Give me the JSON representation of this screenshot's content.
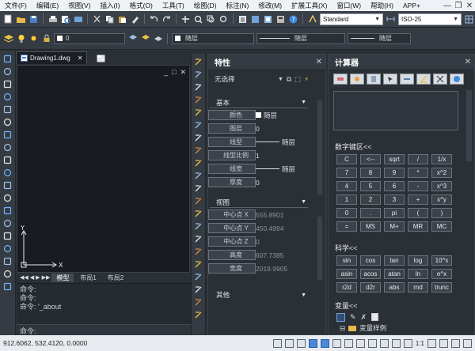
{
  "menu": {
    "items": [
      "文件(F)",
      "编辑(E)",
      "视图(V)",
      "插入(I)",
      "格式(O)",
      "工具(T)",
      "绘图(D)",
      "标注(N)",
      "修改(M)",
      "扩展工具(X)",
      "窗口(W)",
      "帮助(H)",
      "APP+"
    ]
  },
  "toolbar": {
    "text_style": "Standard",
    "dim_style": "ISO-25",
    "table_style": "Standard",
    "layer": "0",
    "color": "随层",
    "linetype": "随层",
    "lineweight": "随层"
  },
  "drawing": {
    "doc_tab": "Drawing1.dwg",
    "view_controls": [
      "_",
      "□",
      "✕"
    ],
    "axis_y": "Y",
    "axis_x": "X",
    "layout_tabs": [
      "模型",
      "布局1",
      "布局2"
    ]
  },
  "command": {
    "lines": [
      "命令:",
      "命令:",
      "命令: '_about",
      "命令:"
    ],
    "prompt": "命令:"
  },
  "properties": {
    "title": "特性",
    "selection": "无选择",
    "sections": {
      "basic": {
        "title": "基本",
        "rows": [
          {
            "k": "颜色",
            "v": "随层"
          },
          {
            "k": "图层",
            "v": "0"
          },
          {
            "k": "线型",
            "v": "随层"
          },
          {
            "k": "线型比例",
            "v": "1"
          },
          {
            "k": "线宽",
            "v": "随层"
          },
          {
            "k": "厚度",
            "v": "0"
          }
        ]
      },
      "view": {
        "title": "视图",
        "rows": [
          {
            "k": "中心点 X",
            "v": "555.8901"
          },
          {
            "k": "中心点 Y",
            "v": "450.4994"
          },
          {
            "k": "中心点 Z",
            "v": "0"
          },
          {
            "k": "高度",
            "v": "607.7385"
          },
          {
            "k": "宽度",
            "v": "2019.9905"
          }
        ]
      },
      "other": {
        "title": "其他"
      }
    }
  },
  "calculator": {
    "title": "计算器",
    "keypad_title": "数字键区<<",
    "keys": [
      "C",
      "<--",
      "sqrt",
      "/",
      "1/x",
      "7",
      "8",
      "9",
      "*",
      "x^2",
      "4",
      "5",
      "6",
      "-",
      "x^3",
      "1",
      "2",
      "3",
      "+",
      "x^y",
      "0",
      ".",
      "pi",
      "(",
      ")",
      "=",
      "MS",
      "M+",
      "MR",
      "MC"
    ],
    "sci_title": "科学<<",
    "sci_keys": [
      "sin",
      "cos",
      "tan",
      "log",
      "10^x",
      "asin",
      "acos",
      "atan",
      "ln",
      "e^x",
      "r2d",
      "d2r",
      "abs",
      "rnd",
      "trunc"
    ],
    "var_title": "变量<<",
    "var_root": "变量样例"
  },
  "status": {
    "coords": "912.6062, 532.4120, 0.0000",
    "scale": "1:1"
  }
}
